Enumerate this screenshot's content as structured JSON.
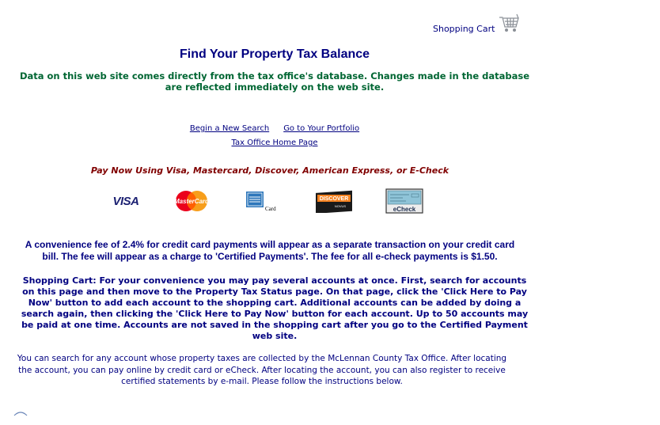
{
  "header": {
    "cart_label": "Shopping Cart"
  },
  "main": {
    "title": "Find Your Property Tax Balance",
    "disclaimer": "Data on this web site comes directly from the tax office's database. Changes made in the database are reflected immediately on the web site.",
    "links": {
      "new_search": "Begin a New Search",
      "portfolio": "Go to Your Portfolio",
      "home": "Tax Office Home Page"
    },
    "pay_now": "Pay Now Using Visa, Mastercard, Discover, American Express, or E-Check",
    "cards": {
      "visa": "VISA",
      "mastercard": "MasterCard",
      "amex_label": "Card",
      "discover": "DISCOVER",
      "discover_sub": "NOVUS",
      "echeck": "eCheck"
    },
    "fee_note": "A convenience fee of 2.4% for credit card payments will appear as a separate transaction on your credit card bill. The fee will appear as a charge to 'Certified Payments'. The fee for all e-check payments is $1.50.",
    "cart_note": "Shopping Cart: For your convenience you may pay several accounts at once. First, search for accounts on this page and then move to the Property Tax Status page. On that page, click the 'Click Here to Pay Now' button to add each account to the shopping cart. Additional accounts can be added by doing a search again, then clicking the 'Click Here to Pay Now' button for each account. Up to 50 accounts may be paid at one time. Accounts are not saved in the shopping cart after you go to the Certified Payment web site.",
    "search_note": "You can search for any account whose property taxes are collected by the McLennan County Tax Office. After locating the account, you can pay online by credit card or eCheck. After locating the account, you can also register to receive certified statements by e-mail. Please follow the instructions below."
  },
  "colors": {
    "navy": "#000080",
    "green": "#006633",
    "maroon": "#800000"
  }
}
